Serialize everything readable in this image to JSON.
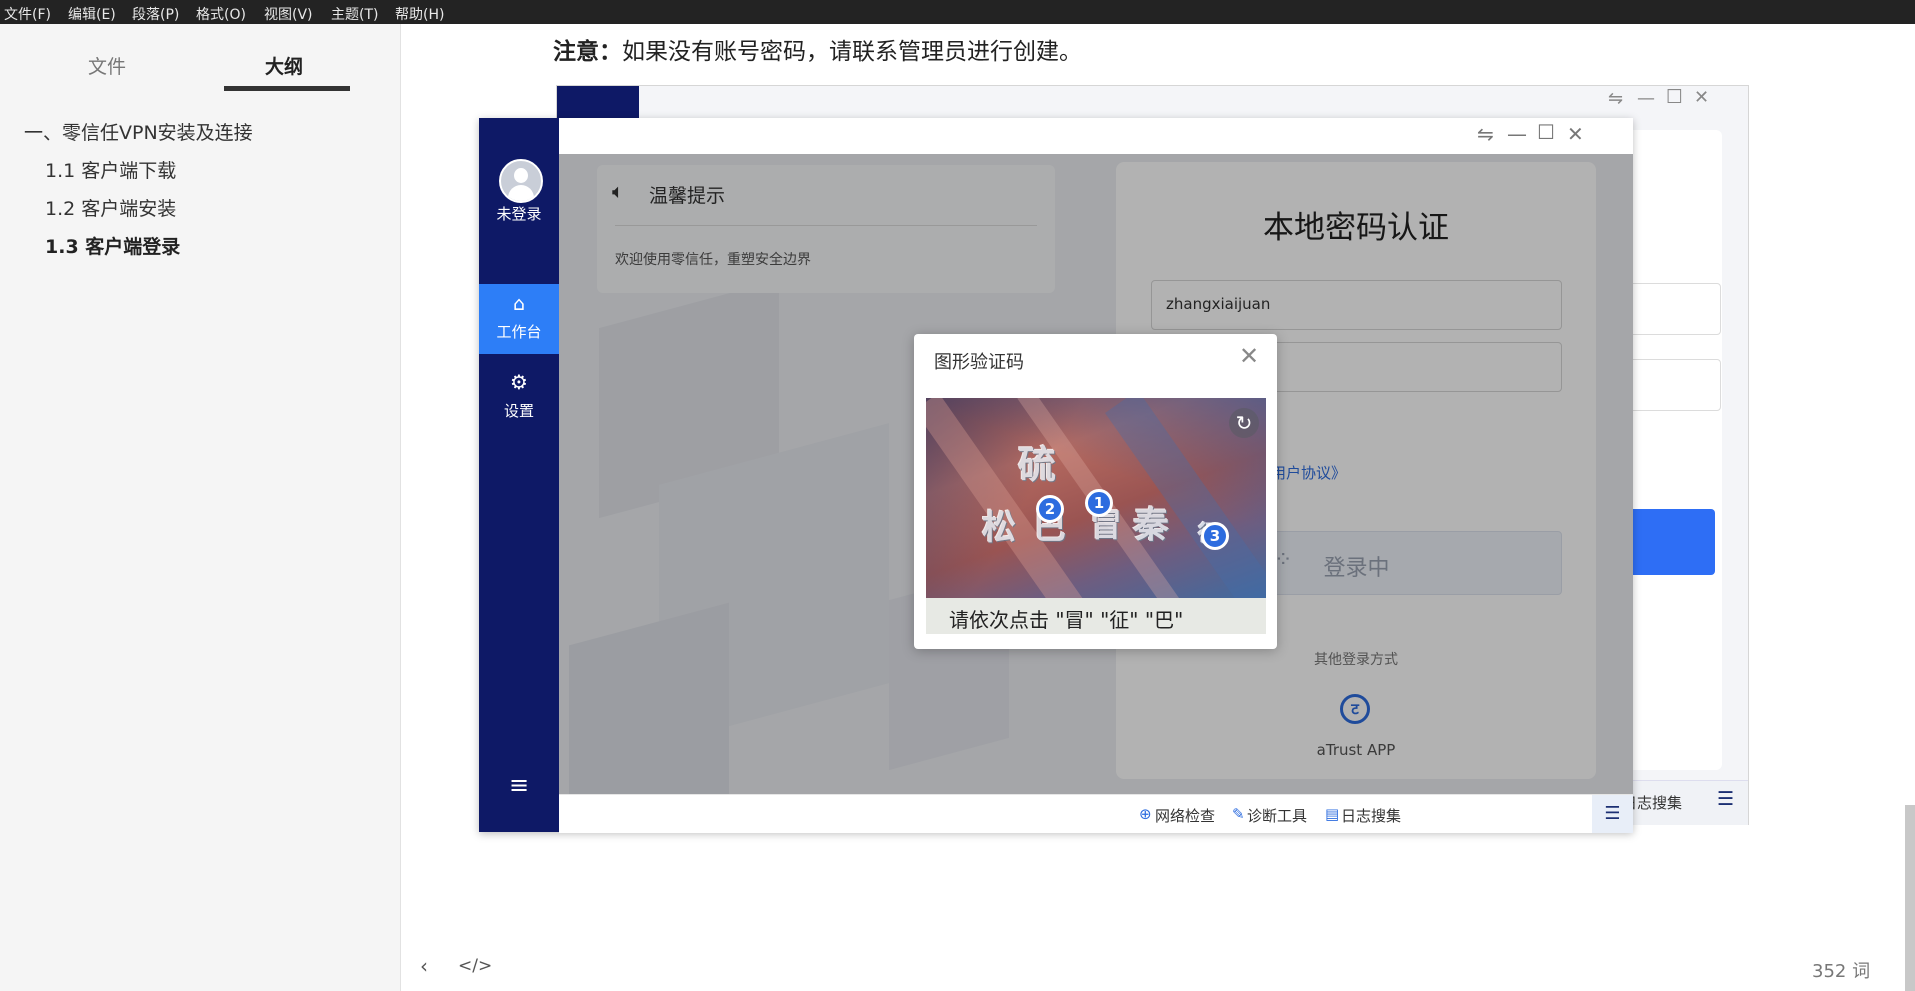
{
  "menubar": {
    "items": [
      "文件(F)",
      "编辑(E)",
      "段落(P)",
      "格式(O)",
      "视图(V)",
      "主题(T)",
      "帮助(H)"
    ]
  },
  "sidebar": {
    "tabs": [
      "文件",
      "大纲"
    ],
    "outline": [
      "一、零信任VPN安装及连接",
      "1.1 客户端下载",
      "1.2 客户端安装",
      "1.3 客户端登录"
    ]
  },
  "doc": {
    "note_label": "注意：",
    "note_text": "如果没有账号密码，请联系管理员进行创建。"
  },
  "app": {
    "window_controls": [
      "⇋",
      "—",
      "☐",
      "✕"
    ],
    "nav": {
      "user_label": "未登录",
      "items": [
        "工作台",
        "设置"
      ],
      "menu_icon": "≡"
    },
    "tip": {
      "title": "温馨提示",
      "body": "欢迎使用零信任，重塑安全边界"
    },
    "login": {
      "title": "本地密码认证",
      "username": "zhangxiaijuan",
      "agreement": "《用户协议》",
      "button": "登录中",
      "other_methods": "其他登录方式",
      "app_label": "aTrust APP"
    },
    "statusbar": [
      "网络检查",
      "诊断工具",
      "日志搜集"
    ]
  },
  "background_window": {
    "window_controls": [
      "⇋",
      "—",
      "☐",
      "✕"
    ],
    "status_text": "日志搜集"
  },
  "captcha": {
    "title": "图形验证码",
    "glyphs": [
      "硫",
      "松",
      "巴",
      "冒",
      "秦",
      "征"
    ],
    "badges": [
      "1",
      "2",
      "3"
    ],
    "instruction": "请依次点击 \"冒\" \"征\" \"巴\""
  },
  "footer": {
    "word_count": "352 词"
  }
}
